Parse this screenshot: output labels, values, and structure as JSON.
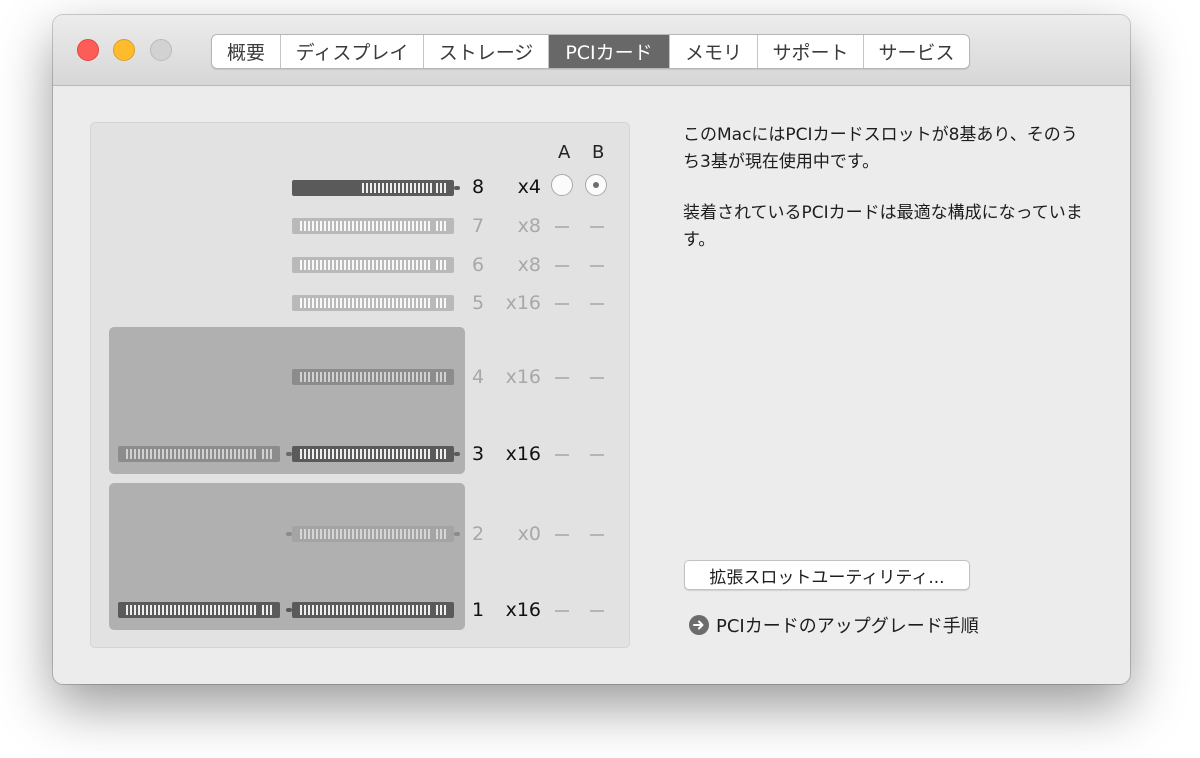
{
  "tabs": [
    {
      "label": "概要",
      "name": "tab-overview"
    },
    {
      "label": "ディスプレイ",
      "name": "tab-display"
    },
    {
      "label": "ストレージ",
      "name": "tab-storage"
    },
    {
      "label": "PCIカード",
      "name": "tab-pci-cards",
      "active": true
    },
    {
      "label": "メモリ",
      "name": "tab-memory"
    },
    {
      "label": "サポート",
      "name": "tab-support"
    },
    {
      "label": "サービス",
      "name": "tab-service"
    }
  ],
  "slots_panel": {
    "column_a": "A",
    "column_b": "B",
    "slots": [
      {
        "number": "8",
        "lanes": "x4",
        "occupied": true,
        "state": "radio"
      },
      {
        "number": "7",
        "lanes": "x8",
        "occupied": false
      },
      {
        "number": "6",
        "lanes": "x8",
        "occupied": false
      },
      {
        "number": "5",
        "lanes": "x16",
        "occupied": false
      },
      {
        "number": "4",
        "lanes": "x16",
        "occupied": false
      },
      {
        "number": "3",
        "lanes": "x16",
        "occupied": true
      },
      {
        "number": "2",
        "lanes": "x0",
        "occupied": false
      },
      {
        "number": "1",
        "lanes": "x16",
        "occupied": true
      }
    ]
  },
  "info": {
    "line1": "このMacにはPCIカードスロットが8基あり、そのうち3基が現在使用中です。",
    "line2": "装着されているPCIカードは最適な構成になっています。"
  },
  "expansion_button": "拡張スロットユーティリティ...",
  "upgrade_link": "PCIカードのアップグレード手順"
}
